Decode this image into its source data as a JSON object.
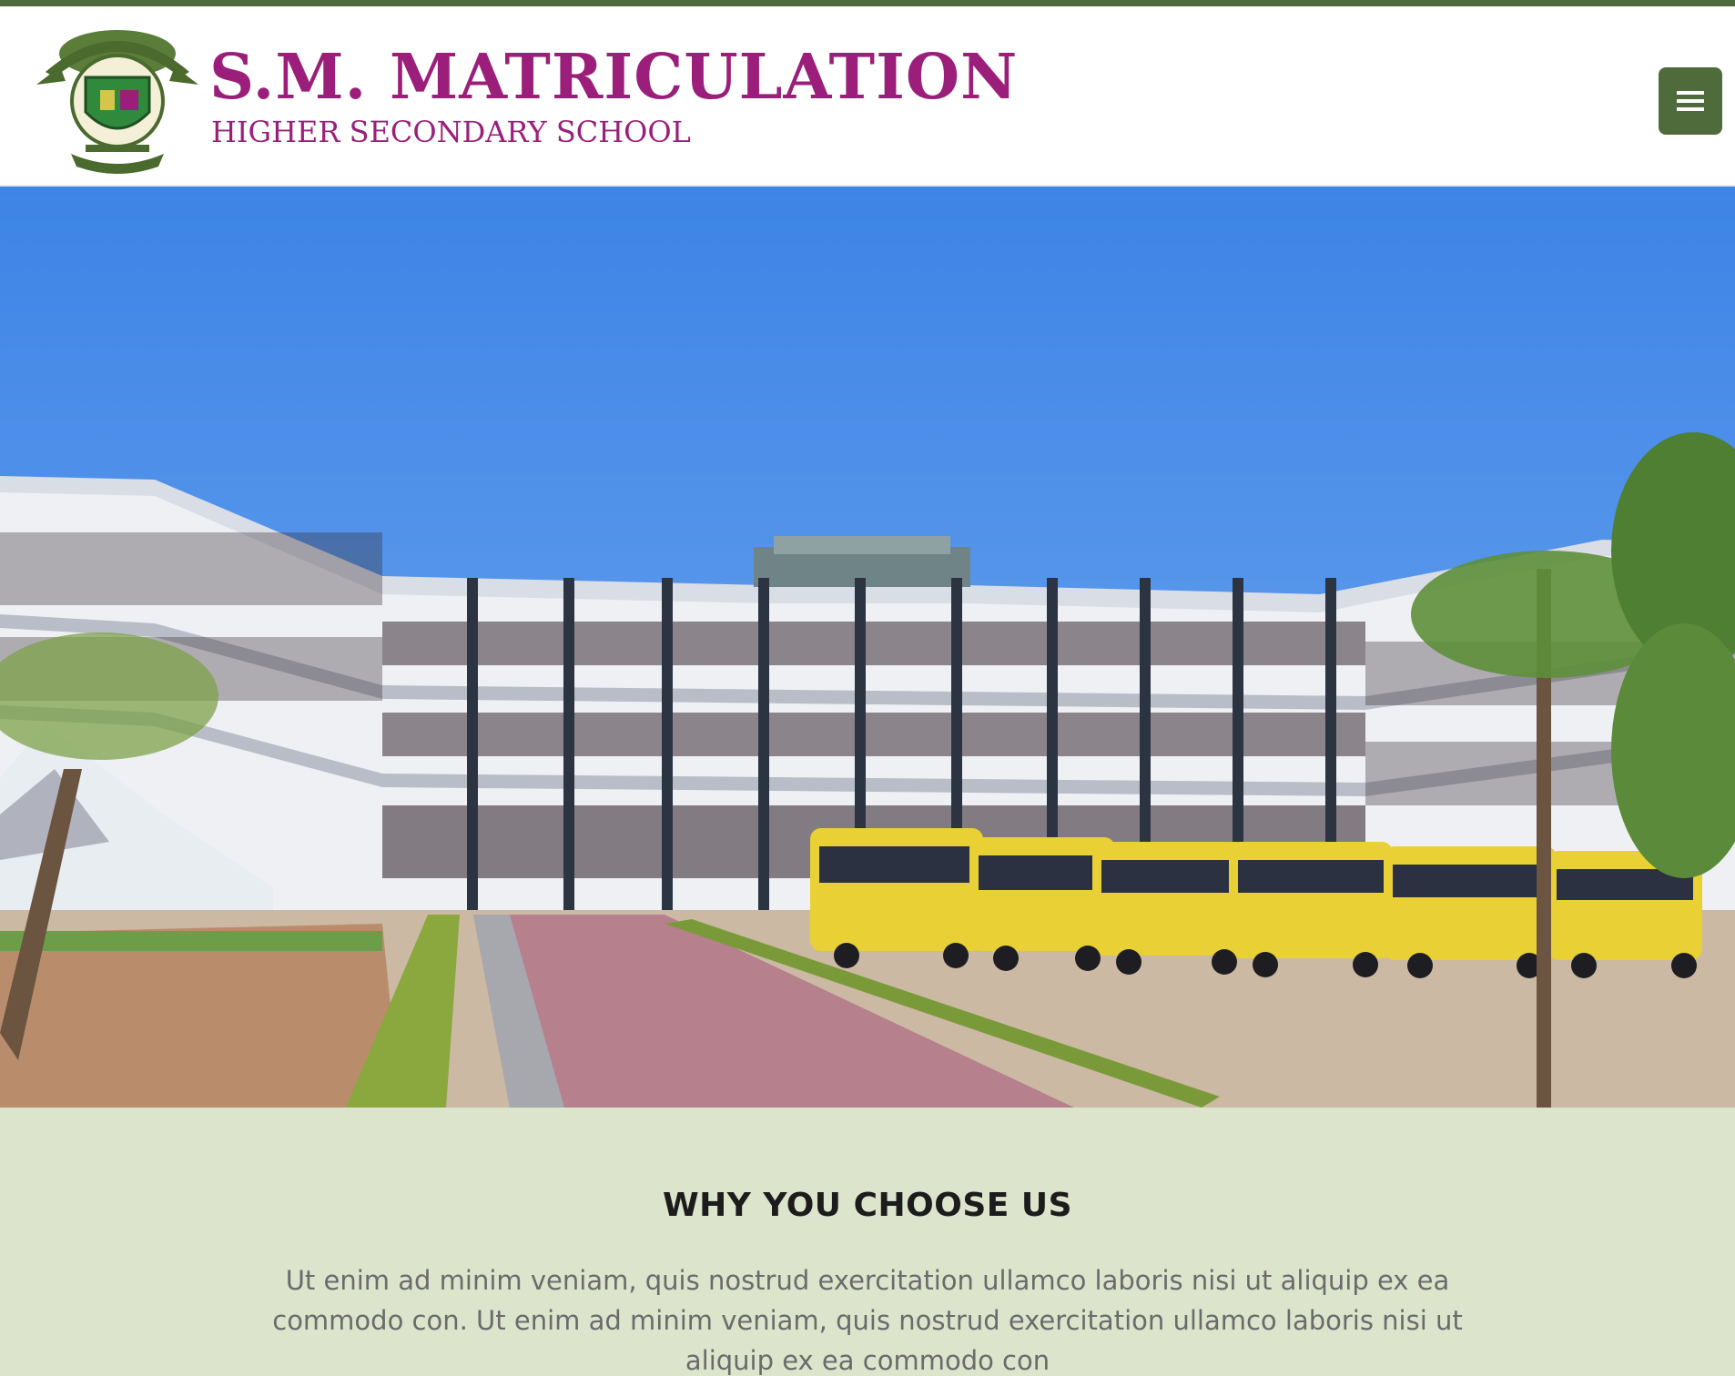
{
  "header": {
    "title": "S.M. MATRICULATION",
    "subtitle": "HIGHER SECONDARY SCHOOL",
    "menu_icon": "hamburger-menu-icon",
    "logo_icon": "school-crest-logo"
  },
  "hero": {
    "image_label": "school-building-with-buses-photo"
  },
  "why": {
    "title": "WHY YOU CHOOSE US",
    "text": "Ut enim ad minim veniam, quis nostrud exercitation ullamco laboris nisi ut aliquip ex ea commodo con. Ut enim ad minim veniam, quis nostrud exercitation ullamco laboris nisi ut aliquip ex ea commodo con"
  },
  "colors": {
    "brand": "#9b1f7a",
    "accent": "#4f6b3c",
    "section_bg": "#dce4cc",
    "sky": "#4f8fe8"
  }
}
